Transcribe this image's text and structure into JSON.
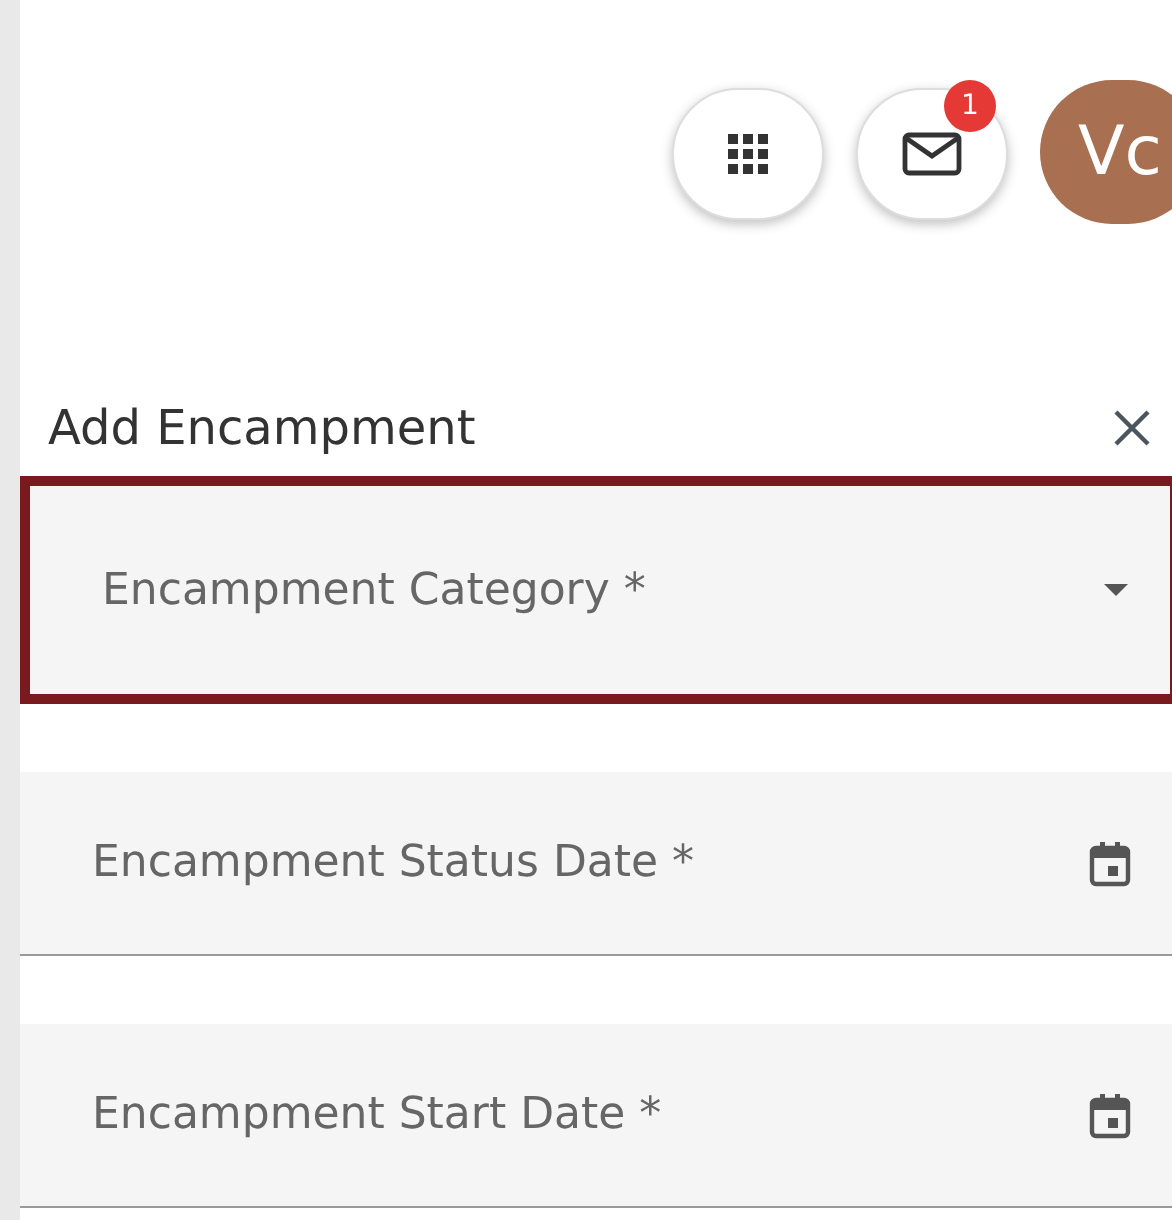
{
  "header": {
    "notifications": {
      "badge": "1"
    },
    "avatar": {
      "initials": "Vc"
    }
  },
  "panel": {
    "title": "Add Encampment",
    "fields": [
      {
        "kind": "select",
        "placeholder": "Encampment Category *",
        "highlighted": true
      },
      {
        "kind": "date",
        "placeholder": "Encampment Status Date *",
        "highlighted": false
      },
      {
        "kind": "date",
        "placeholder": "Encampment Start Date *",
        "highlighted": false
      }
    ]
  }
}
